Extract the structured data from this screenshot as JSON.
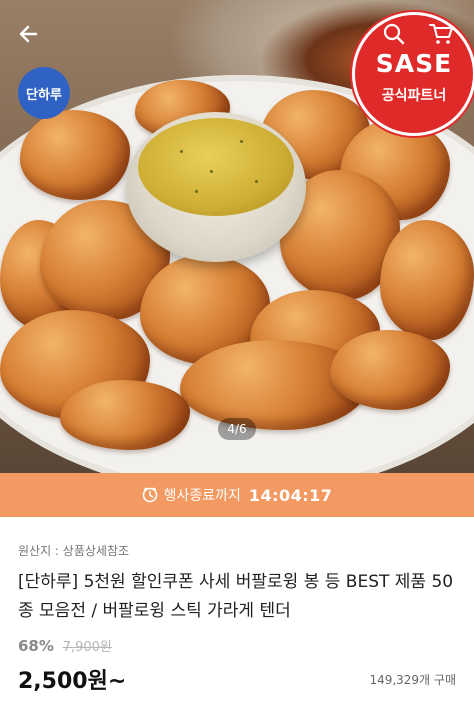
{
  "header": {
    "back_icon": "back-arrow-icon",
    "brand_badge": "단하루",
    "partner_badge": {
      "name": "SASE",
      "label": "공식파트너"
    },
    "icons": [
      "search-icon",
      "cart-icon"
    ]
  },
  "gallery": {
    "page_indicator": "4/6"
  },
  "timer": {
    "icon": "clock-icon",
    "label": "행사종료까지",
    "time": "14:04:17"
  },
  "product": {
    "origin": "원산지 : 상품상세참조",
    "title": "[단하루] 5천원 할인쿠폰 사세 버팔로윙 봉 등 BEST 제품 50종 모음전 / 버팔로윙 스틱 가라게 텐더",
    "discount_rate": "68%",
    "original_price": "7,900원",
    "price": "2,500원~",
    "sold_count": "149,329개 구매"
  },
  "colors": {
    "timer_bar": "#f29a62",
    "brand_badge": "#2f62c4",
    "partner_badge": "#e02a2a"
  }
}
